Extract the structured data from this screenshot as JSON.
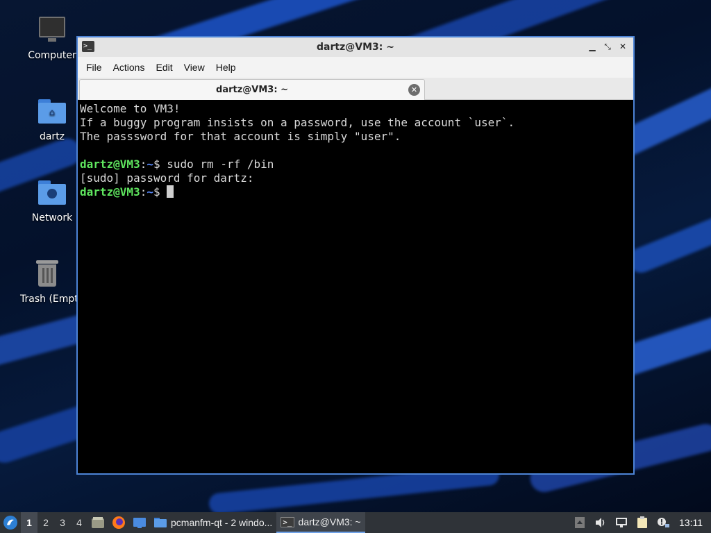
{
  "desktop": {
    "icons": [
      {
        "label": "Computer",
        "icon": "monitor-icon"
      },
      {
        "label": "dartz",
        "icon": "home-folder-icon"
      },
      {
        "label": "Network",
        "icon": "network-folder-icon"
      },
      {
        "label": "Trash (Empty)",
        "icon": "trash-icon"
      }
    ]
  },
  "window": {
    "title": "dartz@VM3: ~",
    "controls": {
      "minimize": "minimize-icon",
      "maximize": "maximize-icon",
      "close": "close-icon"
    },
    "menu": [
      "File",
      "Actions",
      "Edit",
      "View",
      "Help"
    ],
    "tab": {
      "label": "dartz@VM3: ~"
    }
  },
  "terminal": {
    "welcome": [
      "Welcome to VM3!",
      "If a buggy program insists on a password, use the account `user`.",
      "The passsword for that account is simply \"user\"."
    ],
    "prompt_user": "dartz@VM3",
    "prompt_sep": ":",
    "prompt_path": "~",
    "prompt_symbol": "$ ",
    "command": "sudo rm -rf /bin",
    "sudo_prompt": "[sudo] password for dartz:"
  },
  "taskbar": {
    "desktops": [
      "1",
      "2",
      "3",
      "4"
    ],
    "active_desktop": "1",
    "tasks": [
      {
        "label": "pcmanfm-qt - 2 windo...",
        "icon": "folder-icon"
      },
      {
        "label": "dartz@VM3: ~",
        "icon": "terminal-icon"
      }
    ],
    "clock": "13:11"
  },
  "colors": {
    "accent": "#4d84d6",
    "prompt_user": "#5fe65f",
    "prompt_path": "#5a8cff",
    "terminal_bg": "#000000",
    "taskbar_bg": "#2f3338"
  }
}
